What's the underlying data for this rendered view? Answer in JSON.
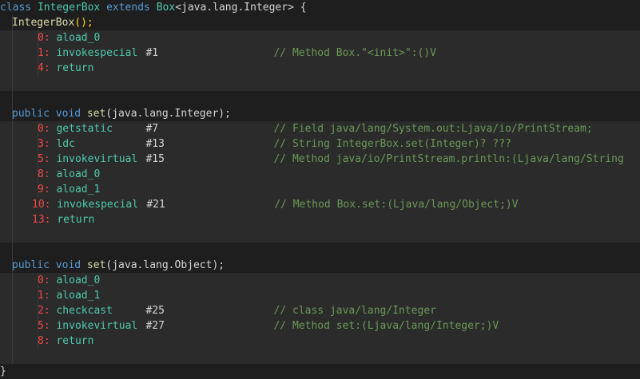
{
  "lines": [
    {
      "type": "class",
      "kw": "class",
      "name": "IntegerBox",
      "kw2": "extends",
      "base": "Box",
      "generic": "<java.lang.Integer>",
      "brace": " {"
    },
    {
      "type": "ctor",
      "name": "IntegerBox",
      "paren": "();"
    },
    {
      "type": "ins",
      "off": "0:",
      "op": "aload_0",
      "arg": "",
      "comment": ""
    },
    {
      "type": "ins",
      "off": "1:",
      "op": "invokespecial",
      "arg": "#1",
      "comment": "// Method Box.\"<init>\":()V"
    },
    {
      "type": "ins",
      "off": "4:",
      "op": "return",
      "arg": "",
      "comment": ""
    },
    {
      "type": "blank"
    },
    {
      "type": "blank"
    },
    {
      "type": "method",
      "mods": "public void",
      "name": "set",
      "params": "(java.lang.Integer);"
    },
    {
      "type": "ins",
      "off": "0:",
      "op": "getstatic",
      "arg": "#7",
      "comment": "// Field java/lang/System.out:Ljava/io/PrintStream;"
    },
    {
      "type": "ins",
      "off": "3:",
      "op": "ldc",
      "arg": "#13",
      "comment": "// String IntegerBox.set(Integer)? ???"
    },
    {
      "type": "ins",
      "off": "5:",
      "op": "invokevirtual",
      "arg": "#15",
      "comment": "// Method java/io/PrintStream.println:(Ljava/lang/String"
    },
    {
      "type": "ins",
      "off": "8:",
      "op": "aload_0",
      "arg": "",
      "comment": ""
    },
    {
      "type": "ins",
      "off": "9:",
      "op": "aload_1",
      "arg": "",
      "comment": ""
    },
    {
      "type": "ins",
      "off": "10:",
      "op": "invokespecial",
      "arg": "#21",
      "comment": "// Method Box.set:(Ljava/lang/Object;)V"
    },
    {
      "type": "ins",
      "off": "13:",
      "op": "return",
      "arg": "",
      "comment": ""
    },
    {
      "type": "blank"
    },
    {
      "type": "blank"
    },
    {
      "type": "method",
      "mods": "public void",
      "name": "set",
      "params": "(java.lang.Object);"
    },
    {
      "type": "ins",
      "off": "0:",
      "op": "aload_0",
      "arg": "",
      "comment": ""
    },
    {
      "type": "ins",
      "off": "1:",
      "op": "aload_1",
      "arg": "",
      "comment": ""
    },
    {
      "type": "ins",
      "off": "2:",
      "op": "checkcast",
      "arg": "#25",
      "comment": "// class java/lang/Integer"
    },
    {
      "type": "ins",
      "off": "5:",
      "op": "invokevirtual",
      "arg": "#27",
      "comment": "// Method set:(Ljava/lang/Integer;)V"
    },
    {
      "type": "ins",
      "off": "8:",
      "op": "return",
      "arg": "",
      "comment": ""
    },
    {
      "type": "blank"
    },
    {
      "type": "close",
      "text": "}"
    }
  ]
}
